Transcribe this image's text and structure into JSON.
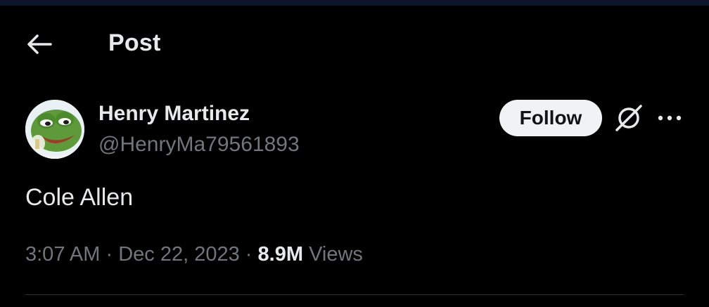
{
  "header": {
    "title": "Post",
    "back_icon": "arrow-left-icon"
  },
  "author": {
    "display_name": "Henry Martinez",
    "handle": "@HenryMa79561893",
    "avatar_icon": "pepe-frog-avatar"
  },
  "actions": {
    "follow_label": "Follow",
    "grok_icon": "grok-icon",
    "more_icon": "more-horizontal-icon"
  },
  "post": {
    "text": "Cole Allen",
    "time": "3:07 AM",
    "separator": "·",
    "date": "Dec 22, 2023",
    "views_count": "8.9M",
    "views_label": "Views"
  },
  "colors": {
    "background": "#000000",
    "primary_text": "#e7e9ea",
    "secondary_text": "#71767b",
    "follow_bg": "#eff3f4",
    "follow_text": "#0f1419",
    "divider": "#2f3336",
    "top_strip": "#0b1428"
  }
}
